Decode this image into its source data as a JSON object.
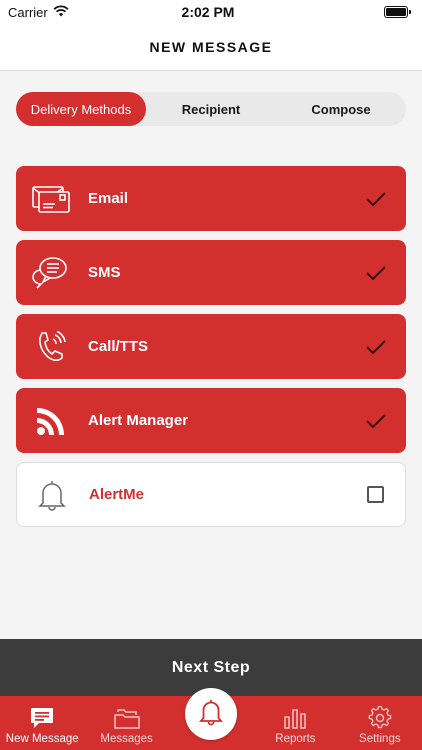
{
  "status_bar": {
    "carrier": "Carrier",
    "time": "2:02 PM"
  },
  "header": {
    "title": "NEW MESSAGE"
  },
  "segments": [
    {
      "label": "Delivery Methods",
      "active": true
    },
    {
      "label": "Recipient",
      "active": false
    },
    {
      "label": "Compose",
      "active": false
    }
  ],
  "methods": [
    {
      "label": "Email",
      "icon": "email-icon",
      "selected": true
    },
    {
      "label": "SMS",
      "icon": "sms-icon",
      "selected": true
    },
    {
      "label": "Call/TTS",
      "icon": "phone-icon",
      "selected": true
    },
    {
      "label": "Alert Manager",
      "icon": "rss-icon",
      "selected": true
    },
    {
      "label": "AlertMe",
      "icon": "bell-icon",
      "selected": false
    }
  ],
  "next_step_label": "Next Step",
  "tabs": [
    {
      "label": "New Message",
      "icon": "new-message-icon",
      "active": true
    },
    {
      "label": "Messages",
      "icon": "folder-icon",
      "active": false
    },
    {
      "label": "Reports",
      "icon": "bar-chart-icon",
      "active": false
    },
    {
      "label": "Settings",
      "icon": "gear-icon",
      "active": false
    }
  ],
  "colors": {
    "accent": "#d32f2f",
    "dark_bar": "#3c3c3c",
    "background": "#f4f4f4"
  }
}
